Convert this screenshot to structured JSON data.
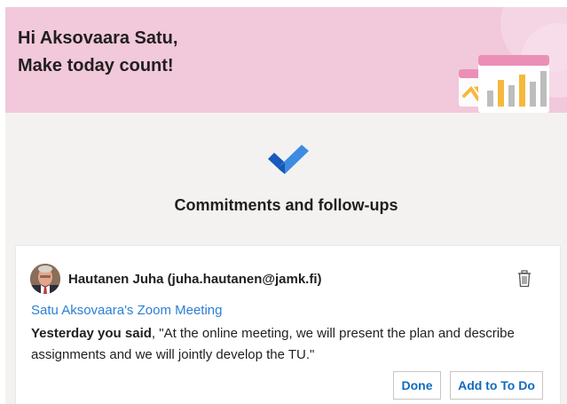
{
  "banner": {
    "greeting_line1": "Hi Aksovaara Satu,",
    "greeting_line2": "Make today count!",
    "background_color": "#f2c8db"
  },
  "section": {
    "icon": "todo-checkmark-icon",
    "title": "Commitments and follow-ups"
  },
  "card": {
    "sender": "Hautanen Juha (juha.hautanen@jamk.fi)",
    "meeting_link": "Satu Aksovaara's Zoom Meeting",
    "quote_lead": "Yesterday you said",
    "quote_text": ", \"At the online meeting, we will present the plan and describe assignments and we will jointly develop the TU.\"",
    "done_label": "Done",
    "add_todo_label": "Add to To Do",
    "delete_icon": "trash-icon",
    "accent_color": "#0f6cbd",
    "link_color": "#2b7fd4"
  }
}
